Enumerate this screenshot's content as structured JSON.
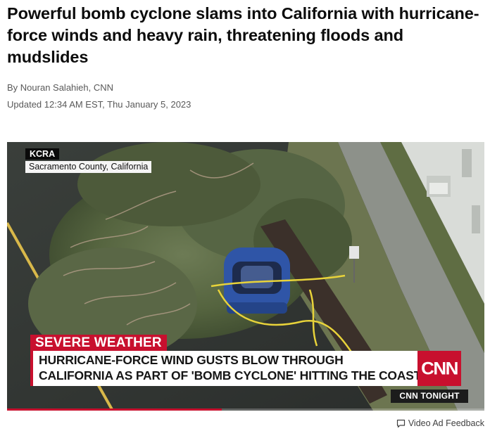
{
  "article": {
    "headline": "Powerful bomb cyclone slams into California with hurricane-force winds and heavy rain, threatening floods and mudslides",
    "byline": "By Nouran Salahieh, CNN",
    "updated": "Updated 12:34 AM EST, Thu January 5, 2023"
  },
  "video": {
    "station_bug": {
      "name": "KCRA",
      "location": "Sacramento County, California"
    },
    "tag": "SEVERE WEATHER",
    "chyron": {
      "line1": "HURRICANE-FORCE WIND GUSTS BLOW THROUGH",
      "line2": "CALIFORNIA AS PART OF 'BOMB CYCLONE' HITTING THE COAST"
    },
    "logo": "CNN",
    "show_name": "CNN TONIGHT",
    "progress": 0.45,
    "colors": {
      "brand_red": "#c8102e"
    }
  },
  "ad_feedback": {
    "icon": "speech-bubble-icon",
    "label": "Video Ad Feedback"
  }
}
